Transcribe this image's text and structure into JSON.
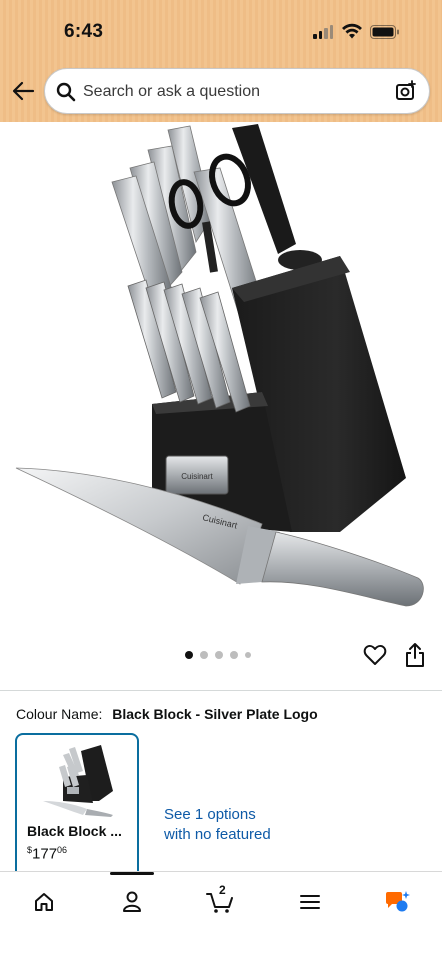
{
  "status_bar": {
    "time": "6:43"
  },
  "search": {
    "placeholder": "Search or ask a question"
  },
  "product": {
    "image_alt": "Cuisinart knife block set",
    "block_logo": "Cuisinart",
    "pager_total": 5,
    "pager_active": 1
  },
  "variation": {
    "label": "Colour Name:",
    "value": "Black Block - Silver Plate Logo",
    "swatch": {
      "name": "Black Block ...",
      "price_symbol": "$",
      "price_whole": "177",
      "price_fraction": "06"
    },
    "see_options": "See 1 options with no featured"
  },
  "bottom_nav": {
    "cart_count": "2",
    "items": [
      "home-icon",
      "account-icon",
      "cart-icon",
      "menu-icon",
      "rufus-icon"
    ]
  },
  "colors": {
    "header": "#f1c089",
    "link": "#0e5aa7",
    "swatch_border": "#0a6e9f",
    "rufus_orange": "#ff6a00",
    "rufus_blue": "#1e7bf0"
  }
}
